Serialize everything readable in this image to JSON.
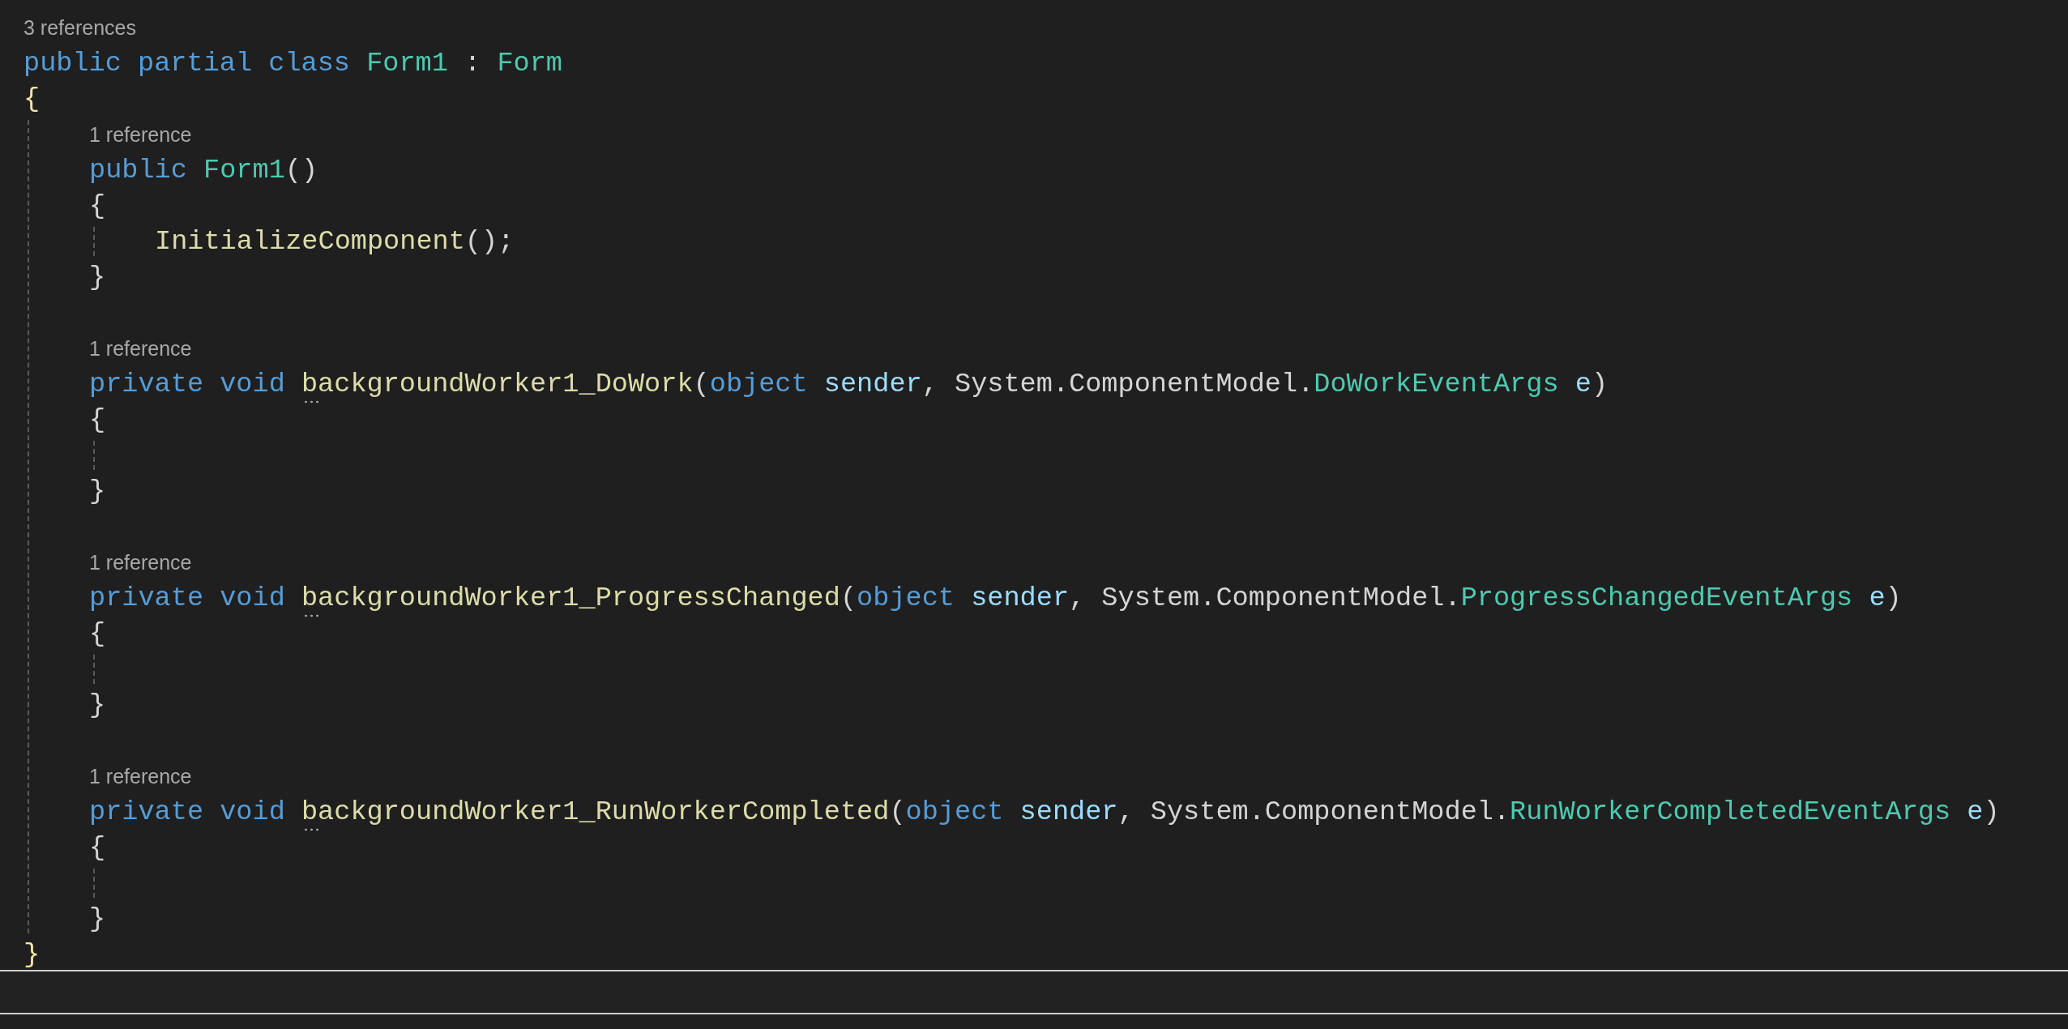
{
  "editor": {
    "lines": [
      {
        "kind": "codelens",
        "text": "3 references"
      },
      {
        "kind": "code",
        "tokens": [
          {
            "t": "public partial class",
            "kind": "keyword"
          },
          {
            "t": " Form1",
            "kind": "type"
          },
          {
            "t": " : "
          },
          {
            "t": "Form",
            "kind": "type"
          }
        ]
      },
      {
        "kind": "code",
        "tokens": [
          {
            "t": "{",
            "kind": "brace"
          }
        ]
      },
      {
        "kind": "block",
        "children": [
          {
            "kind": "codelens",
            "text": "1 reference"
          },
          {
            "kind": "code",
            "tokens": [
              {
                "t": "public",
                "kind": "keyword"
              },
              {
                "t": " Form1",
                "kind": "type"
              },
              {
                "t": "()"
              }
            ]
          },
          {
            "kind": "code",
            "tokens": [
              {
                "t": "{"
              }
            ]
          },
          {
            "kind": "block",
            "children": [
              {
                "kind": "code",
                "tokens": [
                  {
                    "t": "InitializeComponent",
                    "kind": "method"
                  },
                  {
                    "t": "();"
                  }
                ]
              }
            ]
          },
          {
            "kind": "code",
            "tokens": [
              {
                "t": "}"
              }
            ]
          },
          {
            "kind": "blank"
          },
          {
            "kind": "codelens",
            "text": "1 reference"
          },
          {
            "kind": "code",
            "tokens": [
              {
                "t": "private void",
                "kind": "keyword"
              },
              {
                "t": " backgroundWorker1_DoWork",
                "kind": "method",
                "suggestion": true
              },
              {
                "t": "("
              },
              {
                "t": "object",
                "kind": "keyword"
              },
              {
                "t": " sender",
                "kind": "param"
              },
              {
                "t": ", System.ComponentModel."
              },
              {
                "t": "DoWorkEventArgs",
                "kind": "type"
              },
              {
                "t": " e",
                "kind": "param"
              },
              {
                "t": ")"
              }
            ]
          },
          {
            "kind": "code",
            "tokens": [
              {
                "t": "{"
              }
            ]
          },
          {
            "kind": "block",
            "children": [
              {
                "kind": "blank"
              }
            ]
          },
          {
            "kind": "code",
            "tokens": [
              {
                "t": "}"
              }
            ]
          },
          {
            "kind": "blank"
          },
          {
            "kind": "codelens",
            "text": "1 reference"
          },
          {
            "kind": "code",
            "tokens": [
              {
                "t": "private void",
                "kind": "keyword"
              },
              {
                "t": " backgroundWorker1_ProgressChanged",
                "kind": "method",
                "suggestion": true
              },
              {
                "t": "("
              },
              {
                "t": "object",
                "kind": "keyword"
              },
              {
                "t": " sender",
                "kind": "param"
              },
              {
                "t": ", System.ComponentModel."
              },
              {
                "t": "ProgressChangedEventArgs",
                "kind": "type"
              },
              {
                "t": " e",
                "kind": "param"
              },
              {
                "t": ")"
              }
            ]
          },
          {
            "kind": "code",
            "tokens": [
              {
                "t": "{"
              }
            ]
          },
          {
            "kind": "block",
            "children": [
              {
                "kind": "blank"
              }
            ]
          },
          {
            "kind": "code",
            "tokens": [
              {
                "t": "}"
              }
            ]
          },
          {
            "kind": "blank"
          },
          {
            "kind": "codelens",
            "text": "1 reference"
          },
          {
            "kind": "code",
            "tokens": [
              {
                "t": "private void",
                "kind": "keyword"
              },
              {
                "t": " backgroundWorker1_RunWorkerCompleted",
                "kind": "method",
                "suggestion": true
              },
              {
                "t": "("
              },
              {
                "t": "object",
                "kind": "keyword"
              },
              {
                "t": " sender",
                "kind": "param"
              },
              {
                "t": ", System.ComponentModel."
              },
              {
                "t": "RunWorkerCompletedEventArgs",
                "kind": "type"
              },
              {
                "t": " e",
                "kind": "param"
              },
              {
                "t": ")"
              }
            ]
          },
          {
            "kind": "code",
            "tokens": [
              {
                "t": "{"
              }
            ]
          },
          {
            "kind": "block",
            "children": [
              {
                "kind": "blank"
              }
            ]
          },
          {
            "kind": "code",
            "tokens": [
              {
                "t": "}"
              }
            ]
          }
        ]
      },
      {
        "kind": "code",
        "tokens": [
          {
            "t": "}",
            "kind": "brace"
          }
        ]
      }
    ]
  }
}
